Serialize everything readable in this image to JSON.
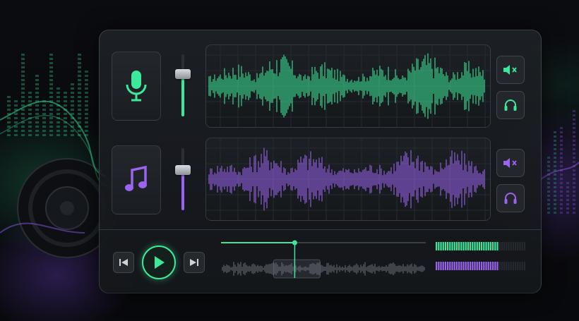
{
  "colors": {
    "green": "#3ee89a",
    "purple": "#9a63f0",
    "panel": "#1c2024",
    "knob": "#c9cdd1"
  },
  "tracks": [
    {
      "name": "voice",
      "icon": "microphone-icon",
      "color": "#3ee89a",
      "fader_level": 0.72,
      "mute_icon": "speaker-mute-icon",
      "monitor_icon": "headphones-icon"
    },
    {
      "name": "music",
      "icon": "music-note-icon",
      "color": "#9a63f0",
      "fader_level": 0.68,
      "mute_icon": "speaker-mute-icon",
      "monitor_icon": "headphones-icon"
    }
  ],
  "transport": {
    "prev_icon": "skip-back-icon",
    "play_icon": "play-icon",
    "next_icon": "skip-forward-icon",
    "playhead_position": 0.36,
    "meters": [
      {
        "color": "#3ee89a",
        "level": 0.68
      },
      {
        "color": "#9a63f0",
        "level": 0.7
      }
    ]
  }
}
